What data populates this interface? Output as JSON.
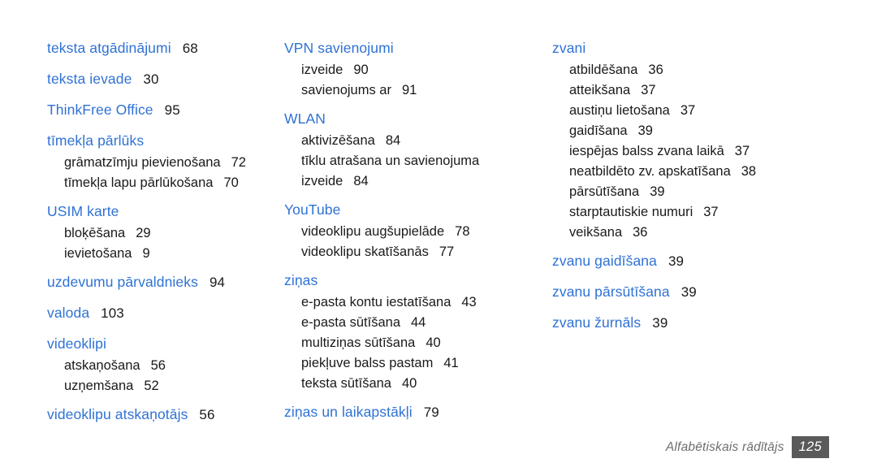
{
  "document": {
    "type": "index",
    "page_number": "125",
    "footer_label": "Alfabētiskais rādītājs",
    "accent_color": "#2f72d4",
    "text_color": "#1a1a1a",
    "footer_color": "#6e6e6e",
    "page_box_color": "#5a5a5a"
  },
  "columns": [
    {
      "name": "column-left",
      "groups": [
        {
          "heading": "teksta atgādinājumi",
          "heading_page": "68",
          "subentries": []
        },
        {
          "heading": "teksta ievade",
          "heading_page": "30",
          "subentries": []
        },
        {
          "heading": "ThinkFree Office",
          "heading_page": "95",
          "subentries": []
        },
        {
          "heading": "tīmekļa pārlūks",
          "heading_page": "",
          "subentries": [
            {
              "label": "grāmatzīmju pievienošana",
              "page": "72"
            },
            {
              "label": "tīmekļa lapu pārlūkošana",
              "page": "70"
            }
          ]
        },
        {
          "heading": "USIM karte",
          "heading_page": "",
          "subentries": [
            {
              "label": "bloķēšana",
              "page": "29"
            },
            {
              "label": "ievietošana",
              "page": "9"
            }
          ]
        },
        {
          "heading": "uzdevumu pārvaldnieks",
          "heading_page": "94",
          "subentries": []
        },
        {
          "heading": "valoda",
          "heading_page": "103",
          "subentries": []
        },
        {
          "heading": "videoklipi",
          "heading_page": "",
          "subentries": [
            {
              "label": "atskaņošana",
              "page": "56"
            },
            {
              "label": "uzņemšana",
              "page": "52"
            }
          ]
        },
        {
          "heading": "videoklipu atskaņotājs",
          "heading_page": "56",
          "subentries": []
        }
      ]
    },
    {
      "name": "column-middle",
      "groups": [
        {
          "heading": "VPN savienojumi",
          "heading_page": "",
          "subentries": [
            {
              "label": "izveide",
              "page": "90"
            },
            {
              "label": "savienojums ar",
              "page": "91"
            }
          ]
        },
        {
          "heading": "WLAN",
          "heading_page": "",
          "subentries": [
            {
              "label": "aktivizēšana",
              "page": "84"
            },
            {
              "label": "tīklu atrašana un savienojuma izveide",
              "page": "84"
            }
          ]
        },
        {
          "heading": "YouTube",
          "heading_page": "",
          "subentries": [
            {
              "label": "videoklipu augšupielāde",
              "page": "78"
            },
            {
              "label": "videoklipu skatīšanās",
              "page": "77"
            }
          ]
        },
        {
          "heading": "ziņas",
          "heading_page": "",
          "subentries": [
            {
              "label": "e-pasta kontu iestatīšana",
              "page": "43"
            },
            {
              "label": "e-pasta sūtīšana",
              "page": "44"
            },
            {
              "label": "multiziņas sūtīšana",
              "page": "40"
            },
            {
              "label": "piekļuve balss pastam",
              "page": "41"
            },
            {
              "label": "teksta sūtīšana",
              "page": "40"
            }
          ]
        },
        {
          "heading": "ziņas un laikapstākļi",
          "heading_page": "79",
          "subentries": []
        }
      ]
    },
    {
      "name": "column-right",
      "groups": [
        {
          "heading": "zvani",
          "heading_page": "",
          "subentries": [
            {
              "label": "atbildēšana",
              "page": "36"
            },
            {
              "label": "atteikšana",
              "page": "37"
            },
            {
              "label": "austiņu lietošana",
              "page": "37"
            },
            {
              "label": "gaidīšana",
              "page": "39"
            },
            {
              "label": "iespējas balss zvana laikā",
              "page": "37"
            },
            {
              "label": "neatbildēto zv. apskatīšana",
              "page": "38"
            },
            {
              "label": "pārsūtīšana",
              "page": "39"
            },
            {
              "label": "starptautiskie numuri",
              "page": "37"
            },
            {
              "label": "veikšana",
              "page": "36"
            }
          ]
        },
        {
          "heading": "zvanu gaidīšana",
          "heading_page": "39",
          "subentries": []
        },
        {
          "heading": "zvanu pārsūtīšana",
          "heading_page": "39",
          "subentries": []
        },
        {
          "heading": "zvanu žurnāls",
          "heading_page": "39",
          "subentries": []
        }
      ]
    }
  ]
}
